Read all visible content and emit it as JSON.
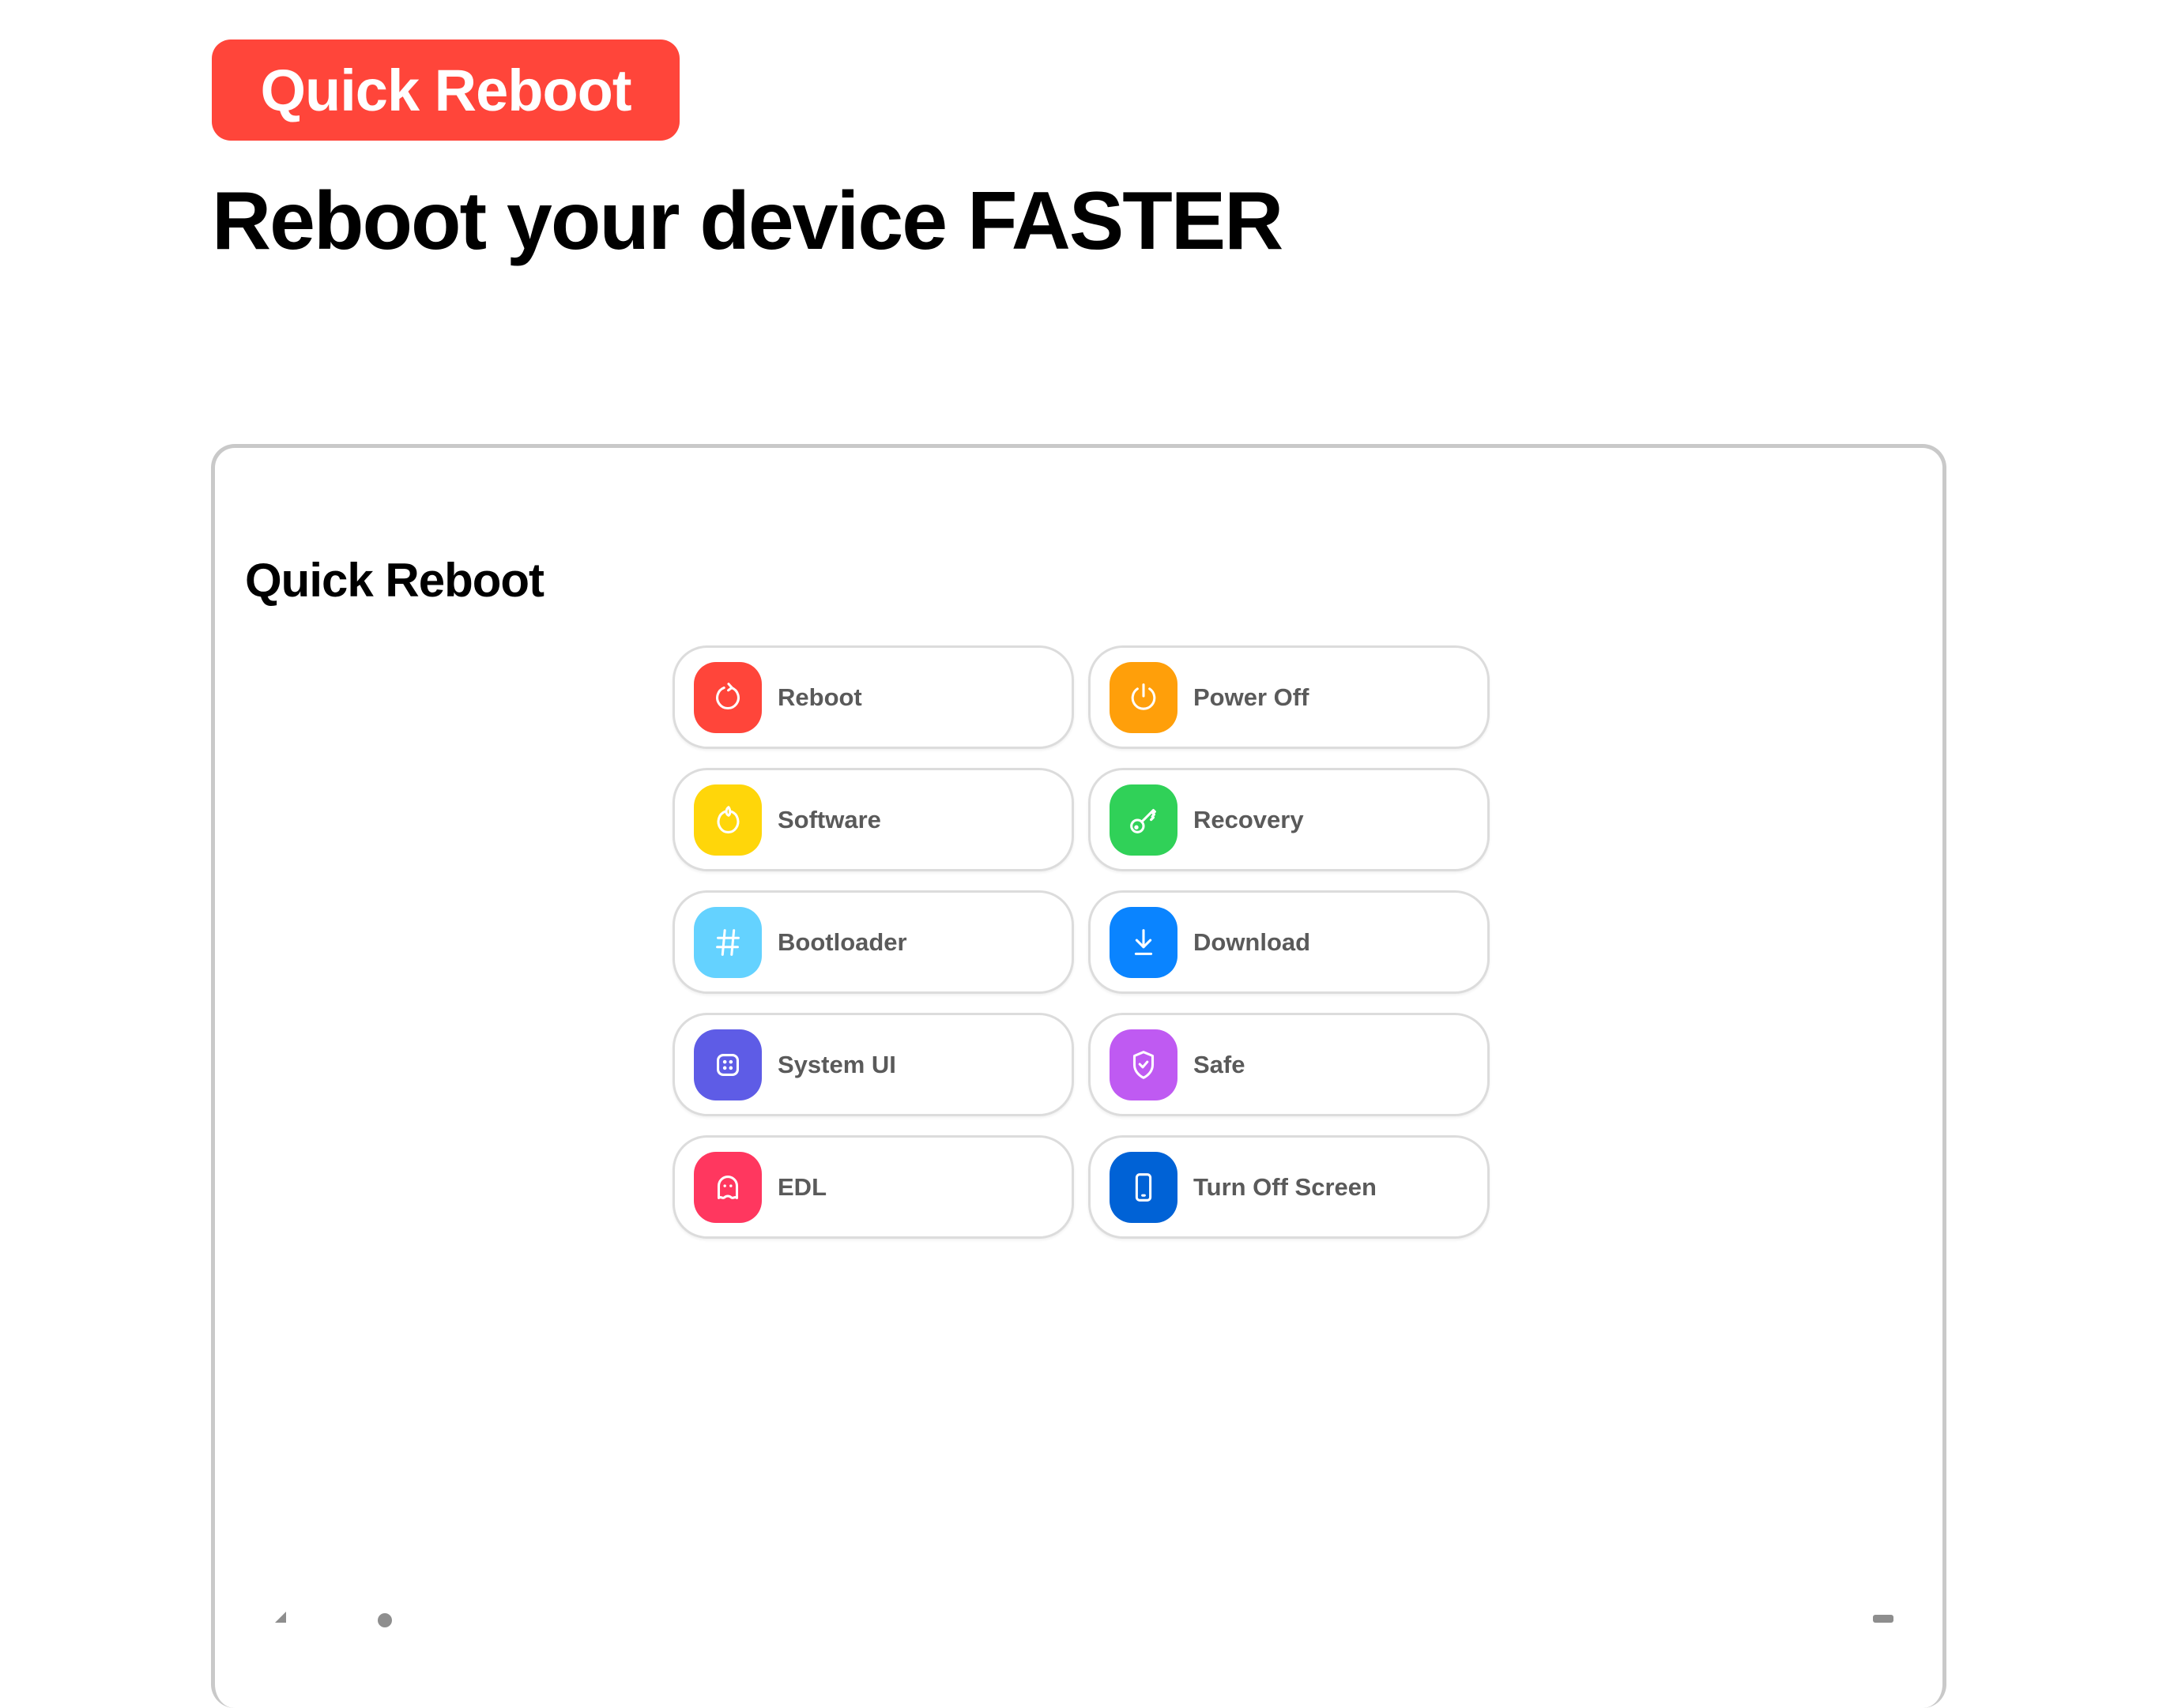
{
  "badge": {
    "label": "Quick Reboot",
    "color": "#FF453A"
  },
  "headline": "Reboot your device FASTER",
  "app": {
    "title": "Quick Reboot",
    "options": [
      {
        "label": "Reboot",
        "icon": "reboot-icon",
        "color": "#FF453A"
      },
      {
        "label": "Power Off",
        "icon": "power-icon",
        "color": "#FF9F0A"
      },
      {
        "label": "Software",
        "icon": "software-restart-icon",
        "color": "#FFD60A"
      },
      {
        "label": "Recovery",
        "icon": "key-icon",
        "color": "#30D158"
      },
      {
        "label": "Bootloader",
        "icon": "hash-icon",
        "color": "#64D2FF"
      },
      {
        "label": "Download",
        "icon": "download-icon",
        "color": "#0A84FF"
      },
      {
        "label": "System UI",
        "icon": "system-ui-icon",
        "color": "#5E5CE6"
      },
      {
        "label": "Safe",
        "icon": "shield-check-icon",
        "color": "#BF5AF2"
      },
      {
        "label": "EDL",
        "icon": "ghost-icon",
        "color": "#FF375F"
      },
      {
        "label": "Turn Off Screen",
        "icon": "phone-icon",
        "color": "#0062D6"
      }
    ]
  }
}
